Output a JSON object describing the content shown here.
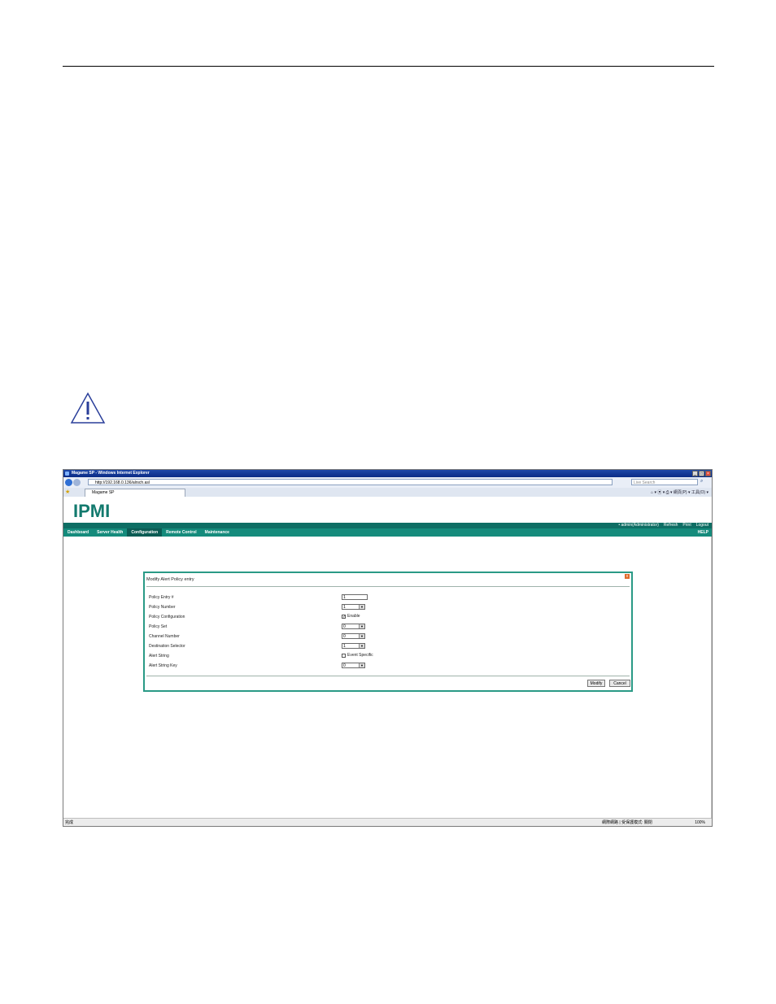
{
  "browser": {
    "title": "Magame SP - Windows Internet Explorer",
    "address": "http://192.168.0.136/alrsch.asl",
    "search_placeholder": "Live Search",
    "tab_title": "Magame SP",
    "command_bar": "⌂ ▾ ▣ ▾ ⎙ ▾ 網頁(P) ▾ 工具(O) ▾",
    "status_left": "完成",
    "status_zone": "網際網路 | 受保護模式: 關閉",
    "status_zoom": "100%"
  },
  "app": {
    "logo": "IPMI",
    "user": "• admin(Administrator)",
    "refresh": "Refresh",
    "print": "Print",
    "logout": "Logout",
    "help": "HELP",
    "menu": [
      "Dashboard",
      "Server Health",
      "Configuration",
      "Remote Control",
      "Maintenance"
    ]
  },
  "dialog": {
    "title": "Modify Alert Policy entry",
    "close": "x",
    "policy_entry_label": "Policy Entry #",
    "policy_entry_value": "1",
    "policy_number_label": "Policy Number",
    "policy_number_value": "1",
    "policy_configuration_label": "Policy Configuration",
    "enable_label": "Enable",
    "policy_set_label": "Policy Set",
    "policy_set_value": "0",
    "channel_number_label": "Channel Number",
    "channel_number_value": "0",
    "destination_selector_label": "Destination Selector",
    "destination_selector_value": "1",
    "alert_string_label": "Alert String",
    "event_specific_label": "Event Specific",
    "alert_string_key_label": "Alert String Key",
    "alert_string_key_value": "0",
    "modify_button": "Modify",
    "cancel_button": "Cancel"
  },
  "colors": {
    "accent": "#158b7c",
    "accent_dark": "#0e6e64",
    "title_bar": "#0a2b86"
  }
}
